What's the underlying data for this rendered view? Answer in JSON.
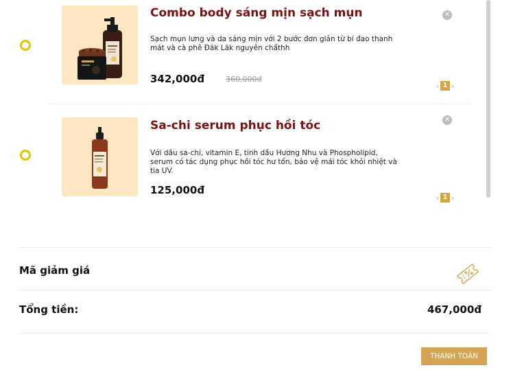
{
  "cart": {
    "items": [
      {
        "title": "Combo body sáng mịn sạch mụn",
        "description": "Sạch mụn lưng và da sáng mịn với 2 bước đơn giản từ bí đao thanh mát và cà phê Đăk Lăk nguyên chấthh",
        "price": "342,000đ",
        "old_price": "360,000đ",
        "quantity": "1",
        "remove_icon": "close-icon",
        "decrease_icon": "chevron-left-icon",
        "increase_icon": "chevron-right-icon"
      },
      {
        "title": "Sa-chi serum phục hồi tóc",
        "description": "Với dầu sa-chi, vitamin E, tinh dầu Hương Nhu và Phospholipid, serum có tác dụng phục hồi tóc hư tổn, bảo vệ mái tóc khỏi nhiệt và tia UV.",
        "price": "125,000đ",
        "quantity": "1",
        "remove_icon": "close-icon",
        "decrease_icon": "chevron-left-icon",
        "increase_icon": "chevron-right-icon"
      }
    ]
  },
  "summary": {
    "coupon_label": "Mã giảm giá",
    "coupon_icon": "coupon-ticket-icon",
    "total_label": "Tổng tiền:",
    "total_value": "467,000đ"
  },
  "actions": {
    "checkout_label": "THANH TOÁN"
  },
  "colors": {
    "title": "#7d1010",
    "radio": "#e1c400",
    "thumb_bg": "#fde7c3",
    "qty_bg": "#d4a640",
    "checkout_bg": "#d4a453"
  }
}
